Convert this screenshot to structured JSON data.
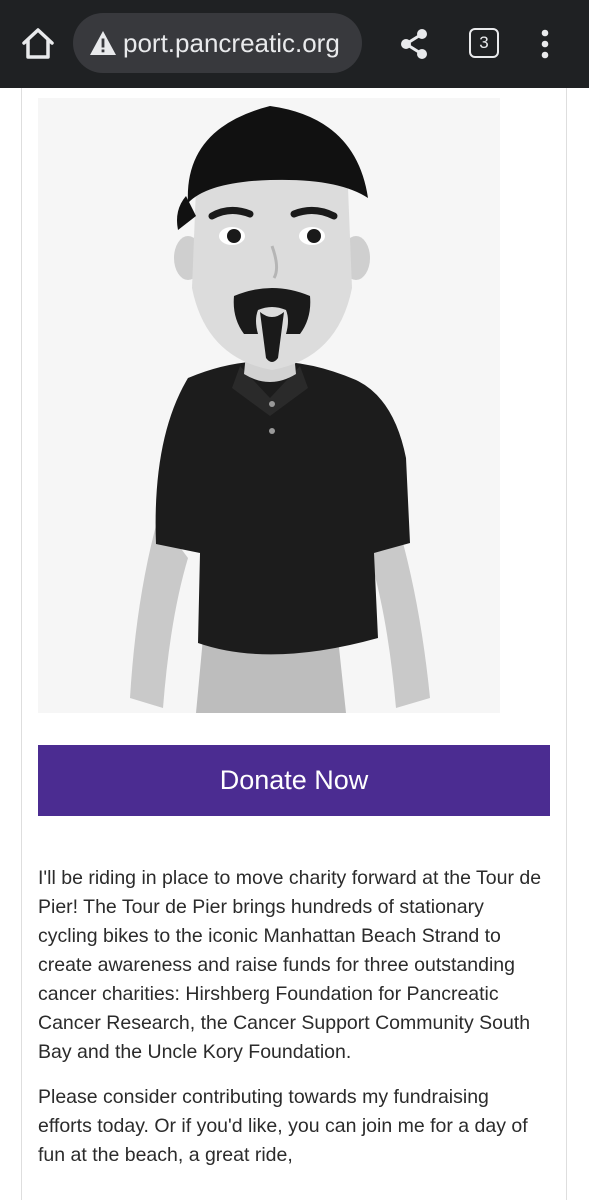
{
  "browser": {
    "url_text": "port.pancreatic.org",
    "tab_count": "3",
    "icons": [
      "home-icon",
      "warning-icon",
      "share-icon",
      "tab-switcher-icon",
      "more-vert-icon"
    ]
  },
  "page": {
    "photo": {
      "subject": "avatar-cartoon-man-in-cap"
    },
    "donate_label": "Donate Now",
    "story": {
      "paragraph_1": "I'll be riding in place to move charity forward at the Tour de Pier! The Tour de Pier brings hundreds of stationary cycling bikes to the iconic Manhattan Beach Strand to create awareness and raise funds for three outstanding cancer charities: Hirshberg Foundation for Pancreatic Cancer Research, the Cancer Support Community South Bay and the Uncle Kory Foundation.",
      "paragraph_2": "Please consider contributing towards my fundraising efforts today. Or if you'd like, you can join me for a day of fun at the beach, a great ride,"
    }
  },
  "colors": {
    "toolbar_bg": "#1f2123",
    "url_pill_bg": "#38393d",
    "donate_button": "#4b2c91",
    "text": "#2b2b2b"
  }
}
